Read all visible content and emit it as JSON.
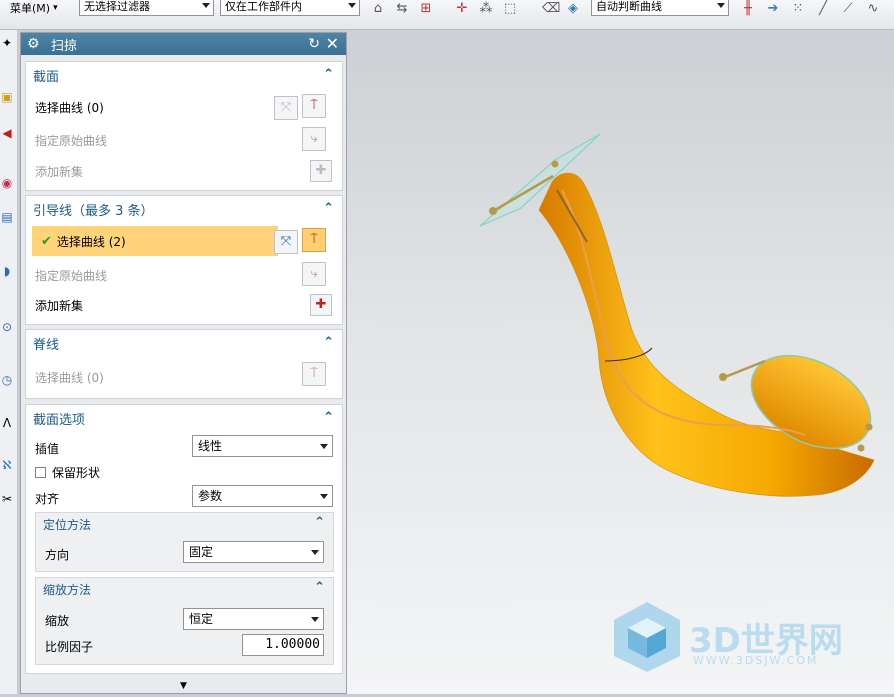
{
  "toolbar": {
    "menu_label": "菜单(M)",
    "filter_value": "无选择过滤器",
    "scope_value": "仅在工作部件内",
    "curve_rule_value": "自动判断曲线"
  },
  "dialog": {
    "title": "扫掠",
    "sections": {
      "section": {
        "title": "截面",
        "select_curve": "选择曲线 (0)",
        "specify_origin": "指定原始曲线",
        "add_new_set": "添加新集"
      },
      "guides": {
        "title": "引导线（最多 3 条）",
        "select_curve": "选择曲线 (2)",
        "specify_origin": "指定原始曲线",
        "add_new_set": "添加新集"
      },
      "spine": {
        "title": "脊线",
        "select_curve": "选择曲线 (0)"
      },
      "options": {
        "title": "截面选项",
        "interpolation_label": "插值",
        "interpolation_value": "线性",
        "preserve_shape_label": "保留形状",
        "alignment_label": "对齐",
        "alignment_value": "参数",
        "orientation": {
          "title": "定位方法",
          "direction_label": "方向",
          "direction_value": "固定"
        },
        "scaling": {
          "title": "缩放方法",
          "scale_label": "缩放",
          "scale_value": "恒定",
          "factor_label": "比例因子",
          "factor_value": "1.00000"
        }
      }
    }
  },
  "watermark": {
    "brand": "3D世界网",
    "url": "WWW.3DSJW.COM"
  },
  "colors": {
    "titlebar": "#3a7093",
    "section_header": "#1d5c86",
    "highlight": "#ffd37a",
    "shape": "#f5a800"
  }
}
